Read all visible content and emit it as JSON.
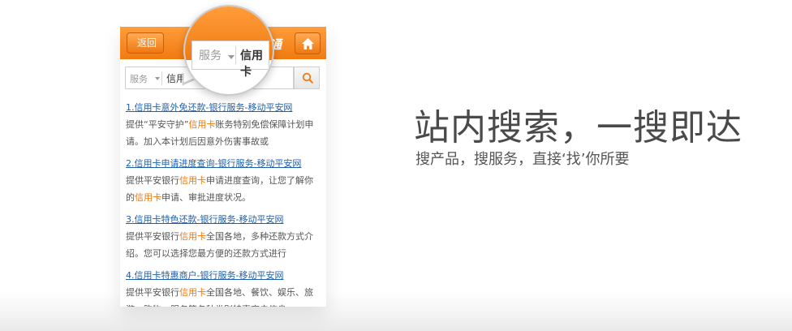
{
  "phone": {
    "back_label": "返回",
    "logo_text": "通",
    "search": {
      "category": "服务",
      "query": "信用"
    }
  },
  "magnifier": {
    "category": "服务",
    "query": "信用卡"
  },
  "results": [
    {
      "title_prefix": "1.",
      "title_highlight": "信用卡",
      "title_rest": "意外免还款-银行服务-移动平安网",
      "desc_before": "提供“平安守护”",
      "desc_highlight": "信用卡",
      "desc_after": "账务特别免偿保障计划申请。加入本计划后因意外伤害事故或"
    },
    {
      "title_prefix": "2.",
      "title_highlight": "信用卡",
      "title_rest": "申请进度查询-银行服务-移动平安网",
      "desc_before": "提供平安银行",
      "desc_highlight": "信用卡",
      "desc_middle": "申请进度查询，让您了解你的",
      "desc_highlight2": "信用卡",
      "desc_after": "申请、审批进度状况。"
    },
    {
      "title_prefix": "3.",
      "title_highlight": "信用卡",
      "title_rest": "特色还款-银行服务-移动平安网",
      "desc_before": "提供平安银行",
      "desc_highlight": "信用卡",
      "desc_after": "全国各地，多种还款方式介绍。您可以选择您最方便的还款方式进行"
    },
    {
      "title_prefix": "4.",
      "title_highlight": "信用卡",
      "title_rest": "特惠商户-银行服务-移动平安网",
      "desc_before": "提供平安银行",
      "desc_highlight": "信用卡",
      "desc_after": "全国各地、餐饮、娱乐、旅游、购物、服务等各种类别特惠商户信息"
    }
  ],
  "headline": "站内搜索，一搜即达",
  "subline": "搜产品，搜服务，直接‘找’你所要",
  "colors": {
    "brand_orange": "#f17a12",
    "link_blue": "#1f5fa8",
    "highlight_orange": "#f0780e"
  }
}
